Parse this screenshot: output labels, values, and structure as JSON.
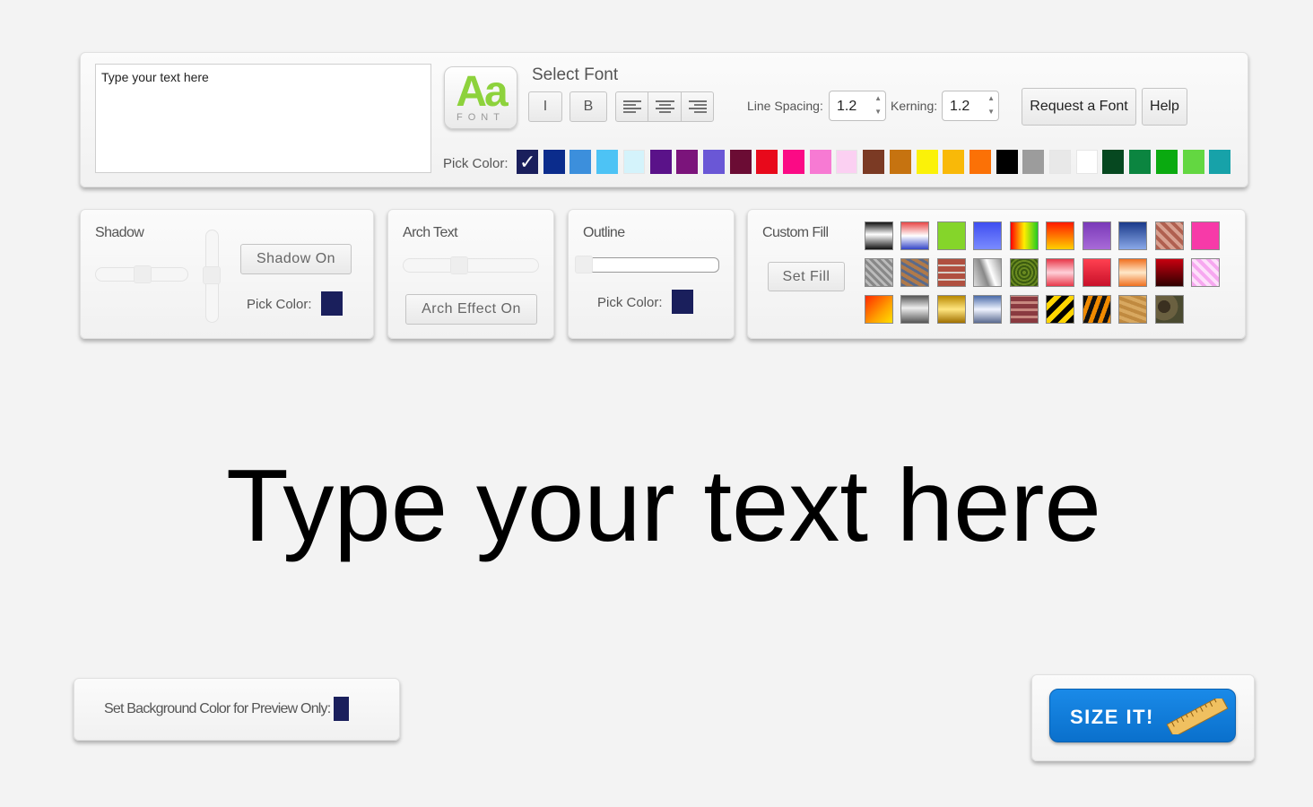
{
  "text_input": {
    "value": "Type your text here"
  },
  "font_logo": {
    "letters": "Aa",
    "sub": "FONT"
  },
  "select_font_label": "Select Font",
  "style_buttons": {
    "italic": "I",
    "bold": "B"
  },
  "line_spacing": {
    "label": "Line Spacing:",
    "value": "1.2"
  },
  "kerning": {
    "label": "Kerning:",
    "value": "1.2"
  },
  "request_font_label": "Request a Font",
  "help_label": "Help",
  "pick_color_label": "Pick Color:",
  "palette": [
    "#1a1f5c",
    "#0b2c8c",
    "#3c8fdc",
    "#4dc3f5",
    "#d4f3fb",
    "#5a1289",
    "#7b147b",
    "#6a57d6",
    "#6b0c34",
    "#e8091b",
    "#fb0a85",
    "#f77ad3",
    "#fbd0f2",
    "#7b3a24",
    "#c67310",
    "#fbf208",
    "#f9b908",
    "#fb7106",
    "#000000",
    "#9c9c9c",
    "#e8e8e8",
    "#ffffff",
    "#064820",
    "#0b8540",
    "#0aaa10",
    "#63d741",
    "#17a2a9"
  ],
  "shadow": {
    "title": "Shadow",
    "button": "Shadow On",
    "pick_color": "Pick Color:",
    "color": "#1a1f5c"
  },
  "arch": {
    "title": "Arch Text",
    "button": "Arch Effect On"
  },
  "outline": {
    "title": "Outline",
    "pick_color": "Pick Color:",
    "color": "#1a1f5c"
  },
  "custom_fill": {
    "title": "Custom Fill",
    "button": "Set Fill"
  },
  "preview_text": "Type your text here",
  "background_panel": {
    "label": "Set Background Color for Preview Only:",
    "color": "#1a1f5c"
  },
  "size_it": {
    "label": "SIZE IT!"
  },
  "colors": {
    "accent": "#0a7ad6",
    "logo_green": "#8dd23c"
  }
}
